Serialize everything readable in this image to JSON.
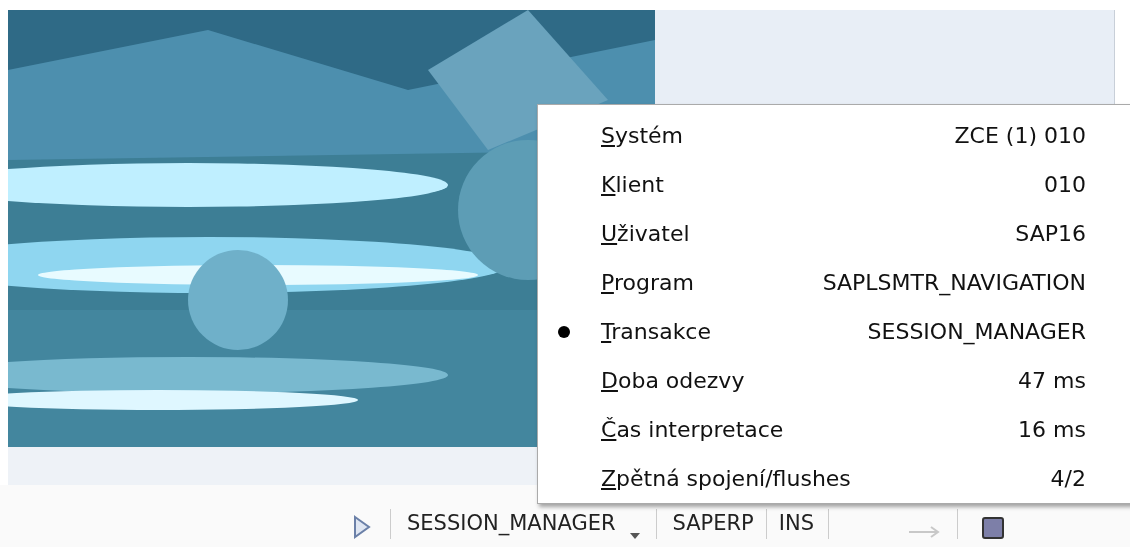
{
  "status_bar": {
    "transaction": "SESSION_MANAGER",
    "system": "SAPERP",
    "mode": "INS"
  },
  "context_menu": {
    "items": [
      {
        "label": "Systém",
        "value": "ZCE (1) 010",
        "selected": false
      },
      {
        "label": "Klient",
        "value": "010",
        "selected": false
      },
      {
        "label": "Uživatel",
        "value": "SAP16",
        "selected": false
      },
      {
        "label": "Program",
        "value": "SAPLSMTR_NAVIGATION",
        "selected": false
      },
      {
        "label": "Transakce",
        "value": "SESSION_MANAGER",
        "selected": true
      },
      {
        "label": "Doba odezvy",
        "value": "47 ms",
        "selected": false
      },
      {
        "label": "Čas interpretace",
        "value": "16 ms",
        "selected": false
      },
      {
        "label": "Zpětná spojení/flushes",
        "value": "4/2",
        "selected": false
      }
    ]
  }
}
